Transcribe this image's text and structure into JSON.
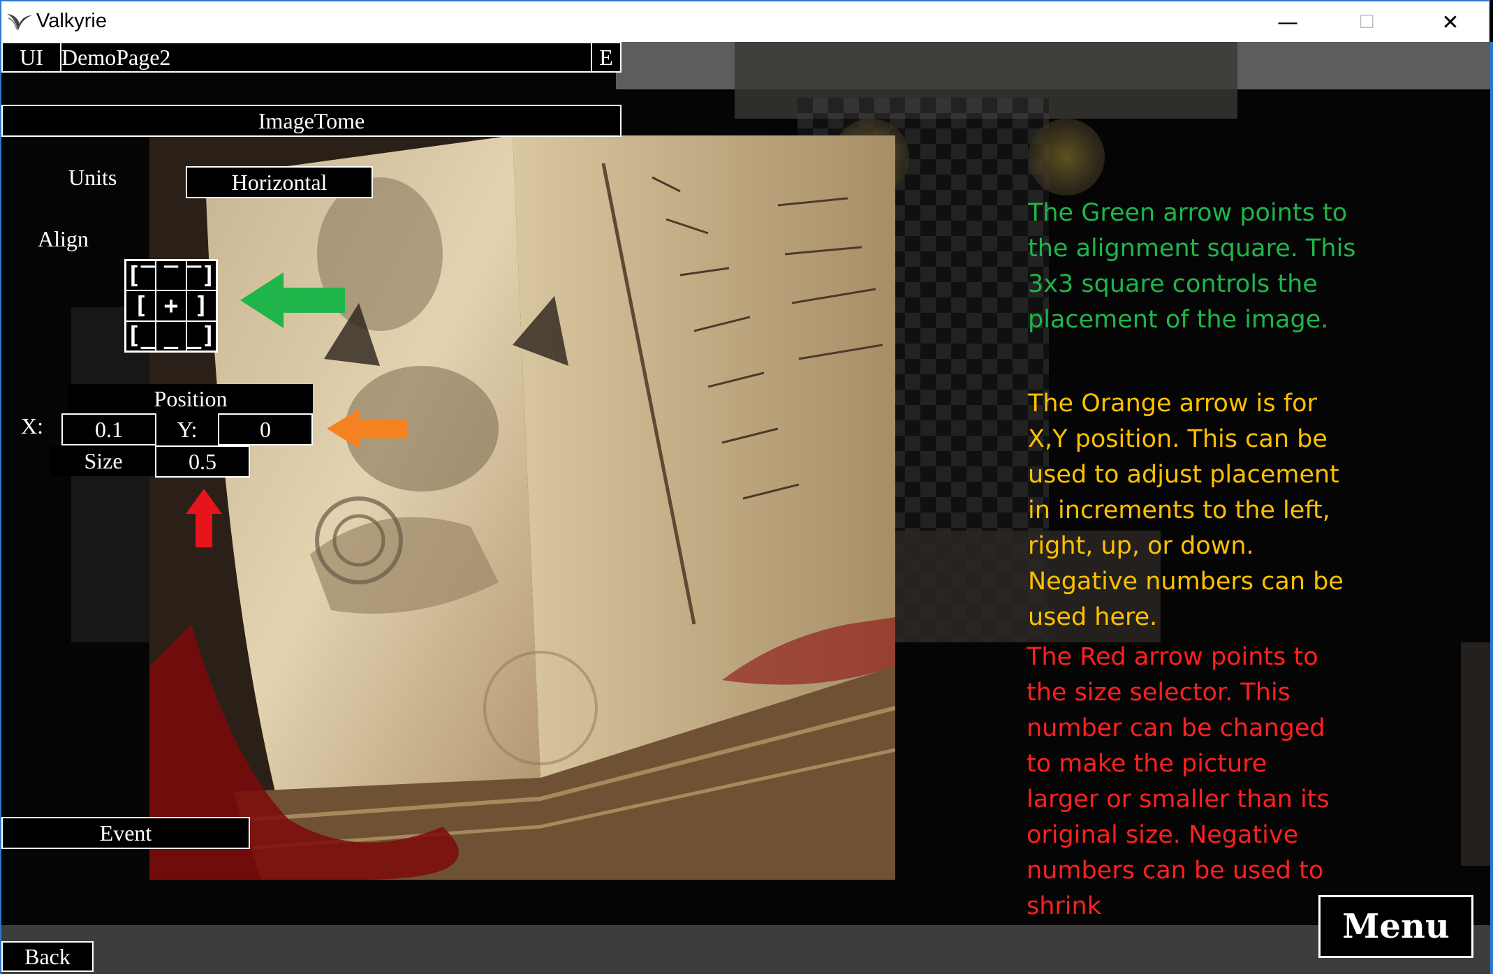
{
  "window": {
    "title": "Valkyrie",
    "minimize": "—",
    "maximize": "☐",
    "close": "✕"
  },
  "editor": {
    "page_name_prefix": "UI",
    "page_name": "DemoPage2",
    "edit_button": "E",
    "image_name": "ImageTome",
    "units_label": "Units",
    "units_value": "Horizontal",
    "align_label": "Align",
    "align_cells": [
      "[‾",
      "‾",
      "‾]",
      "[",
      "+",
      "]",
      "[_",
      "_",
      "_]"
    ],
    "position_label": "Position",
    "x_label": "X:",
    "x_value": "0.1",
    "y_label": "Y:",
    "y_value": "0",
    "size_label": "Size",
    "size_value": "0.5",
    "event_button": "Event"
  },
  "notes": {
    "green": [
      "The Green arrow points to",
      "the alignment square. This",
      "3x3 square controls the",
      "placement of the image."
    ],
    "orange": [
      "The Orange arrow is for",
      "X,Y position. This can be",
      "used to adjust placement",
      "in increments to the left,",
      "right, up, or down.",
      "Negative numbers can be",
      "used here."
    ],
    "red": [
      "The Red arrow points to",
      "the size selector. This",
      "number can be changed",
      "to make the picture",
      "larger or smaller than its",
      "original size. Negative",
      "numbers can be used to",
      "shrink"
    ]
  },
  "colors": {
    "green": "#1fb54a",
    "orange": "#ffc000",
    "red": "#ff2020",
    "orange_arrow": "#f58220"
  },
  "nav": {
    "back": "Back",
    "menu": "Menu"
  }
}
